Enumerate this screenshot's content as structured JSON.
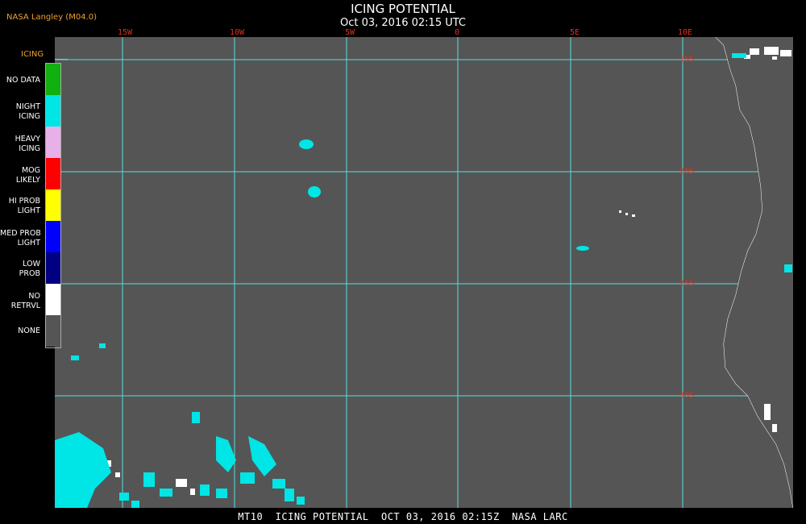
{
  "header": {
    "source": "NASA Langley (M04.0)",
    "title": "ICING POTENTIAL",
    "timestamp": "Oct 03, 2016 02:15 UTC"
  },
  "map": {
    "longitude_labels": [
      "15W",
      "10W",
      "5W",
      "0",
      "5E",
      "10E"
    ],
    "latitude_labels": [
      "15S",
      "20S",
      "25S",
      "30S"
    ],
    "background_color": "#555555",
    "grid_color": "#55e0e0",
    "coastline_color": "#ffffff"
  },
  "legend": {
    "title": "ICING",
    "items": [
      {
        "line1": "NO DATA",
        "line2": "",
        "color": "#10b010"
      },
      {
        "line1": "NIGHT",
        "line2": "ICING",
        "color": "#00e5e5"
      },
      {
        "line1": "HEAVY",
        "line2": "ICING",
        "color": "#e8b0e8"
      },
      {
        "line1": "MOG",
        "line2": "LIKELY",
        "color": "#ff0000"
      },
      {
        "line1": "HI PROB",
        "line2": "LIGHT",
        "color": "#ffff00"
      },
      {
        "line1": "MED PROB",
        "line2": "LIGHT",
        "color": "#0000ff"
      },
      {
        "line1": "LOW",
        "line2": "PROB",
        "color": "#000080"
      },
      {
        "line1": "NO",
        "line2": "RETRVL",
        "color": "#ffffff"
      },
      {
        "line1": "NONE",
        "line2": "",
        "color": "#555555"
      }
    ]
  },
  "footer": {
    "text": "MT10  ICING POTENTIAL  OCT 03, 2016 02:15Z  NASA LARC"
  }
}
